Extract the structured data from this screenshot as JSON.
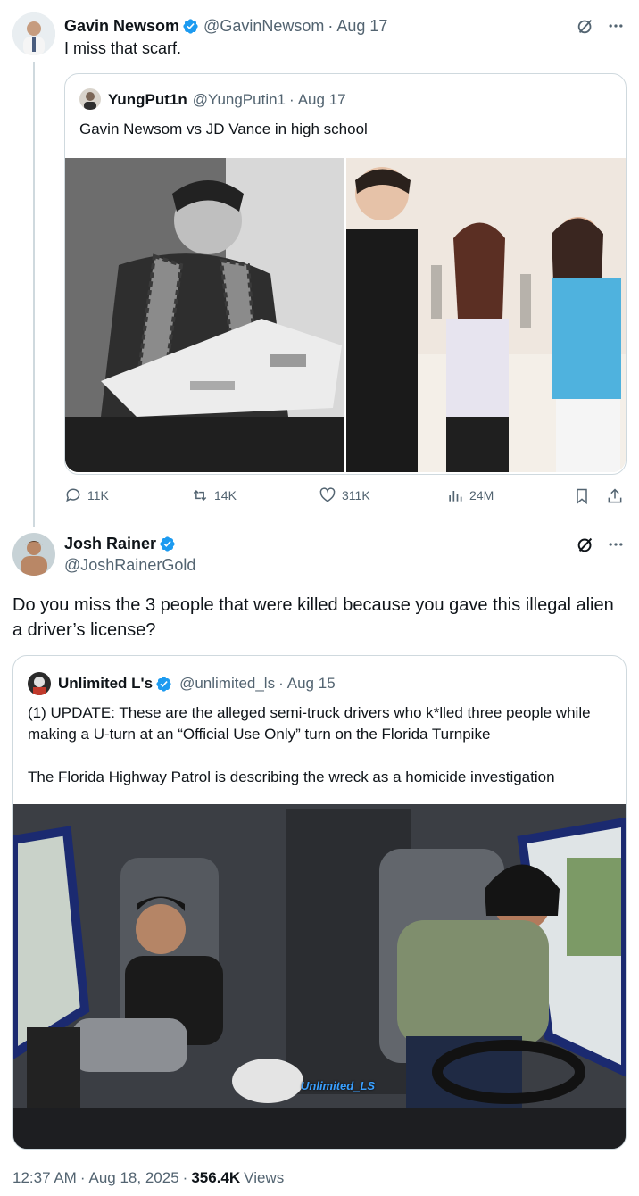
{
  "tweet1": {
    "author_name": "Gavin Newsom",
    "author_handle": "@GavinNewsom",
    "separator": "·",
    "date": "Aug 17",
    "text": "I miss that scarf.",
    "quote": {
      "author_name": "YungPut1n",
      "author_handle": "@YungPutin1",
      "separator": "·",
      "date": "Aug 17",
      "text": "Gavin Newsom vs JD Vance in high school",
      "images": [
        "photo-man-reading-newspaper-with-plaid-scarf",
        "photo-teens-posing-in-restroom"
      ]
    },
    "actions": {
      "replies": "11K",
      "reposts": "14K",
      "likes": "311K",
      "views": "24M"
    }
  },
  "tweet2": {
    "author_name": "Josh Rainer",
    "author_handle": "@JoshRainerGold",
    "text": "Do you miss the 3 people that were killed because you gave this illegal alien a driver’s license?",
    "quote": {
      "author_name": "Unlimited L's",
      "author_handle": "@unlimited_ls",
      "separator": "·",
      "date": "Aug 15",
      "text_1": "(1) UPDATE: These are the alleged semi-truck drivers who k*lled three people while making a U-turn at an “Official Use Only” turn on the Florida Turnpike",
      "text_2": "The Florida Highway Patrol is describing the wreck as a homicide investigation",
      "image_watermark": "Unlimited_LS"
    },
    "footer": {
      "time": "12:37 AM",
      "separator": "·",
      "date": "Aug 18, 2025",
      "separator2": "·",
      "views_count": "356.4K",
      "views_label": "Views"
    }
  },
  "colors": {
    "verified": "#1d9bf0",
    "secondary_text": "#536471",
    "border": "#cfd9de"
  },
  "icons": [
    "grok-icon",
    "more-icon",
    "reply-icon",
    "repost-icon",
    "like-icon",
    "views-icon",
    "bookmark-icon",
    "share-icon",
    "verified-badge-icon"
  ]
}
